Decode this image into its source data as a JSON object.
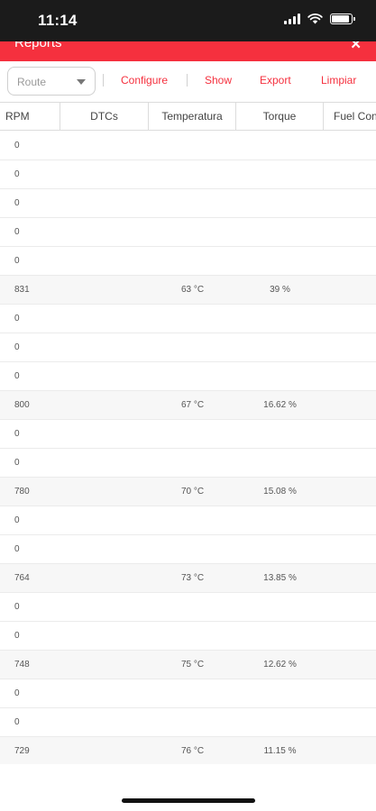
{
  "status_bar": {
    "time": "11:14"
  },
  "header": {
    "title": "Reports",
    "close_icon": "close-icon",
    "color": "#f5303e"
  },
  "toolbar": {
    "select_value": "Route",
    "buttons": [
      "Configure",
      "Show",
      "Export",
      "Limpiar"
    ]
  },
  "table": {
    "columns": [
      "RPM",
      "DTCs",
      "Temperatura",
      "Torque",
      "Fuel Con"
    ],
    "rows": [
      {
        "rpm": "0",
        "dtcs": "",
        "temp": "",
        "torque": "",
        "fuel": ""
      },
      {
        "rpm": "0",
        "dtcs": "",
        "temp": "",
        "torque": "",
        "fuel": ""
      },
      {
        "rpm": "0",
        "dtcs": "",
        "temp": "",
        "torque": "",
        "fuel": ""
      },
      {
        "rpm": "0",
        "dtcs": "",
        "temp": "",
        "torque": "",
        "fuel": ""
      },
      {
        "rpm": "0",
        "dtcs": "",
        "temp": "",
        "torque": "",
        "fuel": ""
      },
      {
        "rpm": "831",
        "dtcs": "",
        "temp": "63 °C",
        "torque": "39 %",
        "fuel": ""
      },
      {
        "rpm": "0",
        "dtcs": "",
        "temp": "",
        "torque": "",
        "fuel": ""
      },
      {
        "rpm": "0",
        "dtcs": "",
        "temp": "",
        "torque": "",
        "fuel": ""
      },
      {
        "rpm": "0",
        "dtcs": "",
        "temp": "",
        "torque": "",
        "fuel": ""
      },
      {
        "rpm": "800",
        "dtcs": "",
        "temp": "67 °C",
        "torque": "16.62 %",
        "fuel": ""
      },
      {
        "rpm": "0",
        "dtcs": "",
        "temp": "",
        "torque": "",
        "fuel": ""
      },
      {
        "rpm": "0",
        "dtcs": "",
        "temp": "",
        "torque": "",
        "fuel": ""
      },
      {
        "rpm": "780",
        "dtcs": "",
        "temp": "70 °C",
        "torque": "15.08 %",
        "fuel": ""
      },
      {
        "rpm": "0",
        "dtcs": "",
        "temp": "",
        "torque": "",
        "fuel": ""
      },
      {
        "rpm": "0",
        "dtcs": "",
        "temp": "",
        "torque": "",
        "fuel": ""
      },
      {
        "rpm": "764",
        "dtcs": "",
        "temp": "73 °C",
        "torque": "13.85 %",
        "fuel": ""
      },
      {
        "rpm": "0",
        "dtcs": "",
        "temp": "",
        "torque": "",
        "fuel": ""
      },
      {
        "rpm": "0",
        "dtcs": "",
        "temp": "",
        "torque": "",
        "fuel": ""
      },
      {
        "rpm": "748",
        "dtcs": "",
        "temp": "75 °C",
        "torque": "12.62 %",
        "fuel": ""
      },
      {
        "rpm": "0",
        "dtcs": "",
        "temp": "",
        "torque": "",
        "fuel": ""
      },
      {
        "rpm": "0",
        "dtcs": "",
        "temp": "",
        "torque": "",
        "fuel": ""
      },
      {
        "rpm": "729",
        "dtcs": "",
        "temp": "76 °C",
        "torque": "11.15 %",
        "fuel": ""
      }
    ]
  }
}
